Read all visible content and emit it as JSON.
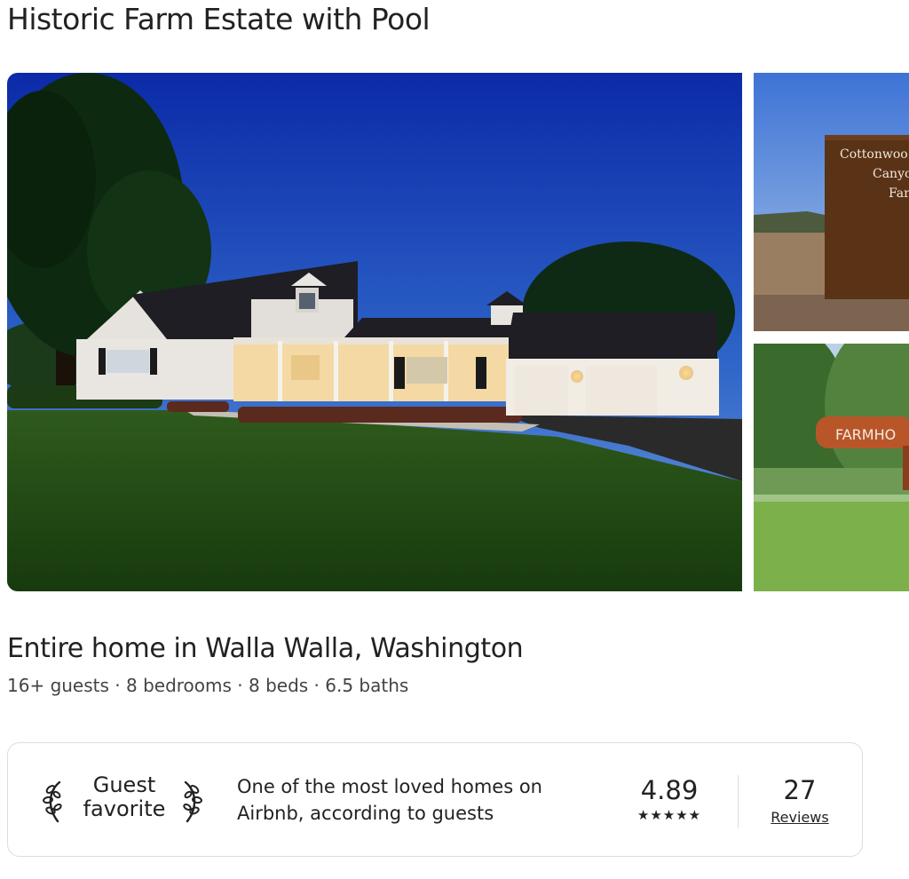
{
  "listing": {
    "title": "Historic Farm Estate with Pool",
    "subtitle": "Entire home in Walla Walla, Washington",
    "details": "16+ guests · 8 bedrooms · 8 beds · 6.5 baths"
  },
  "gallery": {
    "sign_top": {
      "line1": "Cottonwoo",
      "line2": "Canyo",
      "line3": "Far"
    },
    "sign_bottom": "FARMHO"
  },
  "guest_favorite": {
    "label_line1": "Guest",
    "label_line2": "favorite",
    "description_line1": "One of the most loved homes on",
    "description_line2": "Airbnb, according to guests",
    "rating": "4.89",
    "stars": "★★★★★",
    "star_count": 5,
    "reviews_count": "27",
    "reviews_label": "Reviews"
  },
  "icons": {
    "laurel": "laurel-icon",
    "star": "star-icon"
  },
  "colors": {
    "text": "#222222",
    "secondary_text": "#444444",
    "border": "#dddddd"
  }
}
